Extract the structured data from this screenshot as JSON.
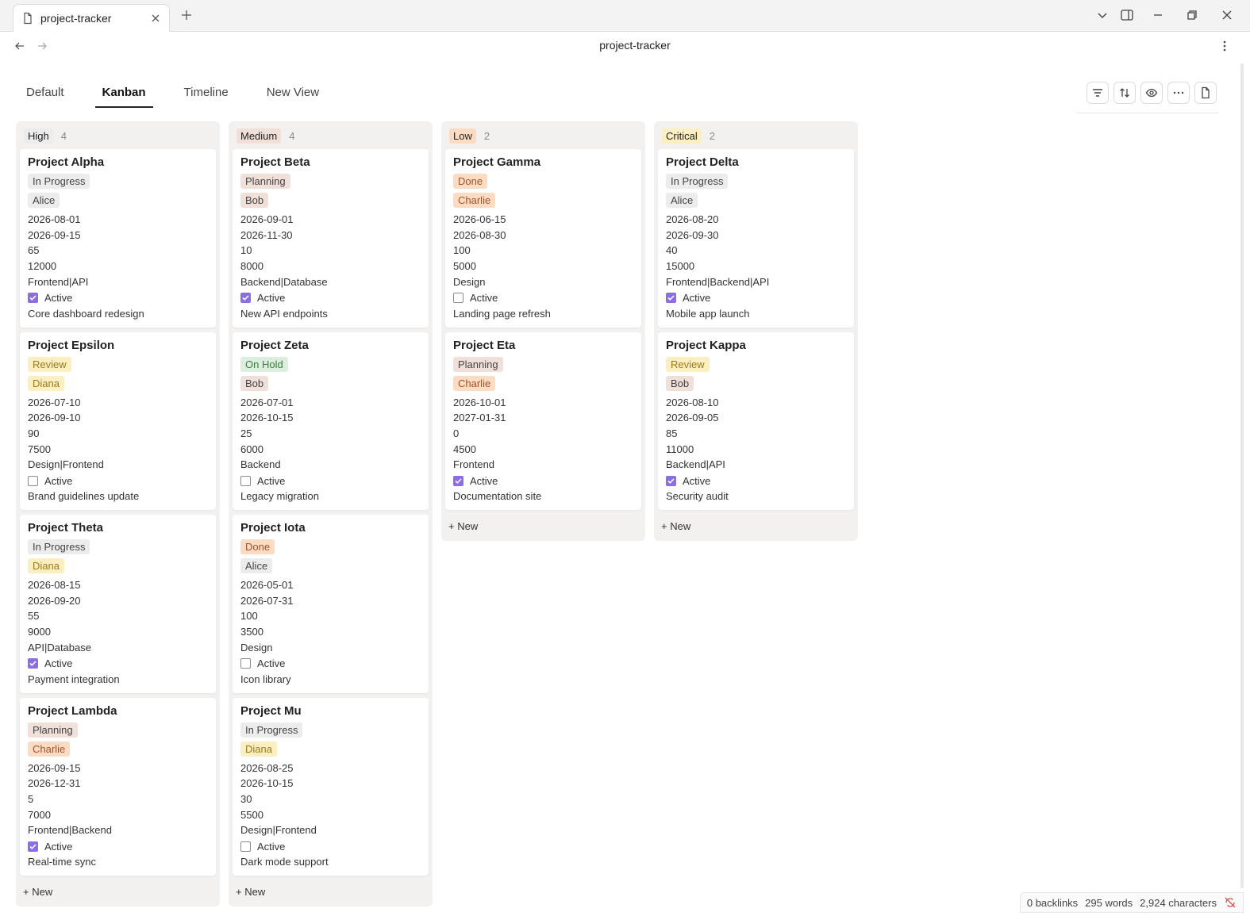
{
  "tab": {
    "title": "project-tracker"
  },
  "doc": {
    "title": "project-tracker"
  },
  "views": [
    {
      "label": "Default"
    },
    {
      "label": "Kanban"
    },
    {
      "label": "Timeline"
    },
    {
      "label": "New View"
    }
  ],
  "active_view": "Kanban",
  "toolbar_icons": [
    "filter-icon",
    "sort-icon",
    "eye-icon",
    "more-horizontal-icon",
    "document-icon"
  ],
  "colors": {
    "checkbox_accent": "#8b6ee6",
    "in_progress_bg": "#ececec",
    "planning_bg": "#f0e0d9",
    "done_bg": "#fbdcc3",
    "review_bg": "#fbefc1",
    "on_hold_bg": "#dceedd",
    "person_alice_bg": "#ececec",
    "person_bob_bg": "#f0e0d9",
    "person_charlie_bg": "#fbdcc3",
    "person_diana_bg": "#fbefc1",
    "group_high_bg": "#ececec",
    "group_medium_bg": "#f0e0d9",
    "group_low_bg": "#fbdcc3",
    "group_critical_bg": "#fbefc1"
  },
  "columns": [
    {
      "label": "High",
      "count": "4",
      "cards": [
        {
          "title": "Project Alpha",
          "status": "In Progress",
          "owner": "Alice",
          "start": "2026-08-01",
          "end": "2026-09-15",
          "progress": "65",
          "budget": "12000",
          "tags": "Frontend|API",
          "active": true,
          "active_label": "Active",
          "description": "Core dashboard redesign"
        },
        {
          "title": "Project Epsilon",
          "status": "Review",
          "owner": "Diana",
          "start": "2026-07-10",
          "end": "2026-09-10",
          "progress": "90",
          "budget": "7500",
          "tags": "Design|Frontend",
          "active": false,
          "active_label": "Active",
          "description": "Brand guidelines update"
        },
        {
          "title": "Project Theta",
          "status": "In Progress",
          "owner": "Diana",
          "start": "2026-08-15",
          "end": "2026-09-20",
          "progress": "55",
          "budget": "9000",
          "tags": "API|Database",
          "active": true,
          "active_label": "Active",
          "description": "Payment integration"
        },
        {
          "title": "Project Lambda",
          "status": "Planning",
          "owner": "Charlie",
          "start": "2026-09-15",
          "end": "2026-12-31",
          "progress": "5",
          "budget": "7000",
          "tags": "Frontend|Backend",
          "active": true,
          "active_label": "Active",
          "description": "Real-time sync"
        }
      ],
      "new_label": "+ New"
    },
    {
      "label": "Medium",
      "count": "4",
      "cards": [
        {
          "title": "Project Beta",
          "status": "Planning",
          "owner": "Bob",
          "start": "2026-09-01",
          "end": "2026-11-30",
          "progress": "10",
          "budget": "8000",
          "tags": "Backend|Database",
          "active": true,
          "active_label": "Active",
          "description": "New API endpoints"
        },
        {
          "title": "Project Zeta",
          "status": "On Hold",
          "owner": "Bob",
          "start": "2026-07-01",
          "end": "2026-10-15",
          "progress": "25",
          "budget": "6000",
          "tags": "Backend",
          "active": false,
          "active_label": "Active",
          "description": "Legacy migration"
        },
        {
          "title": "Project Iota",
          "status": "Done",
          "owner": "Alice",
          "start": "2026-05-01",
          "end": "2026-07-31",
          "progress": "100",
          "budget": "3500",
          "tags": "Design",
          "active": false,
          "active_label": "Active",
          "description": "Icon library"
        },
        {
          "title": "Project Mu",
          "status": "In Progress",
          "owner": "Diana",
          "start": "2026-08-25",
          "end": "2026-10-15",
          "progress": "30",
          "budget": "5500",
          "tags": "Design|Frontend",
          "active": false,
          "active_label": "Active",
          "description": "Dark mode support"
        }
      ],
      "new_label": "+ New"
    },
    {
      "label": "Low",
      "count": "2",
      "cards": [
        {
          "title": "Project Gamma",
          "status": "Done",
          "owner": "Charlie",
          "start": "2026-06-15",
          "end": "2026-08-30",
          "progress": "100",
          "budget": "5000",
          "tags": "Design",
          "active": false,
          "active_label": "Active",
          "description": "Landing page refresh"
        },
        {
          "title": "Project Eta",
          "status": "Planning",
          "owner": "Charlie",
          "start": "2026-10-01",
          "end": "2027-01-31",
          "progress": "0",
          "budget": "4500",
          "tags": "Frontend",
          "active": true,
          "active_label": "Active",
          "description": "Documentation site"
        }
      ],
      "new_label": "+ New"
    },
    {
      "label": "Critical",
      "count": "2",
      "cards": [
        {
          "title": "Project Delta",
          "status": "In Progress",
          "owner": "Alice",
          "start": "2026-08-20",
          "end": "2026-09-30",
          "progress": "40",
          "budget": "15000",
          "tags": "Frontend|Backend|API",
          "active": true,
          "active_label": "Active",
          "description": "Mobile app launch"
        },
        {
          "title": "Project Kappa",
          "status": "Review",
          "owner": "Bob",
          "start": "2026-08-10",
          "end": "2026-09-05",
          "progress": "85",
          "budget": "11000",
          "tags": "Backend|API",
          "active": true,
          "active_label": "Active",
          "description": "Security audit"
        }
      ],
      "new_label": "+ New"
    }
  ],
  "status_bar": {
    "backlinks": "0 backlinks",
    "words": "295 words",
    "characters": "2,924 characters"
  }
}
